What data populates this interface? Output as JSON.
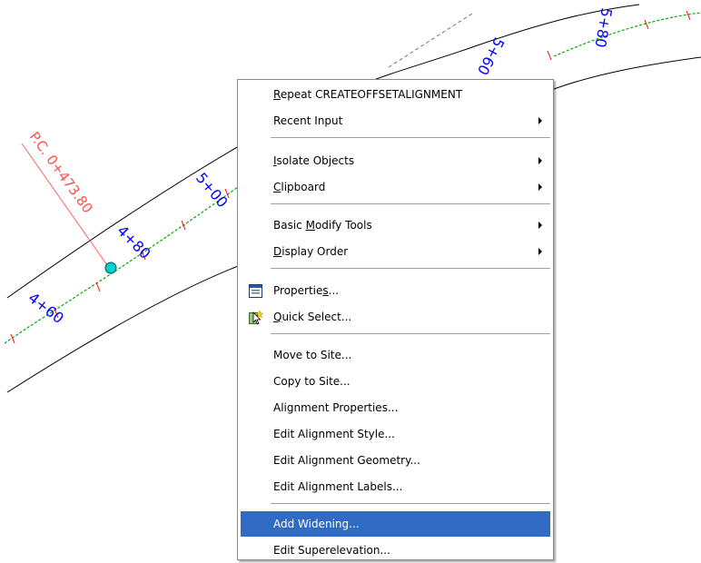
{
  "drawing": {
    "station_labels": [
      "4+60",
      "4+80",
      "5+00",
      "5+60",
      "5+80"
    ],
    "pc_label": "P.C. 0+473.80",
    "colors": {
      "alignment_line": "#00aa00",
      "station_text": "#0000ff",
      "pc_text": "#ff5050",
      "tick": "#ff0000",
      "point": "#00d0d0",
      "edge": "#000000"
    }
  },
  "context_menu": {
    "items": [
      {
        "label": "Repeat CREATEOFFSETALIGNMENT",
        "underline": "R",
        "rest": "epeat CREATEOFFSETALIGNMENT"
      },
      {
        "label": "Recent Input",
        "submenu": true
      },
      {
        "label": "Isolate Objects",
        "underline": "I",
        "rest": "solate Objects",
        "submenu": true
      },
      {
        "label": "Clipboard",
        "underline": "C",
        "rest": "lipboard",
        "submenu": true
      },
      {
        "label": "Basic Modify Tools",
        "pre": "Basic ",
        "underline": "M",
        "rest": "odify Tools",
        "submenu": true
      },
      {
        "label": "Display Order",
        "underline": "D",
        "rest": "isplay Order",
        "submenu": true
      },
      {
        "label": "Properties...",
        "pre": "Propertie",
        "underline": "s",
        "rest": "...",
        "icon": "properties-icon"
      },
      {
        "label": "Quick Select...",
        "underline": "Q",
        "rest": "uick Select...",
        "icon": "quick-select-icon"
      },
      {
        "label": "Move to Site..."
      },
      {
        "label": "Copy to Site..."
      },
      {
        "label": "Alignment Properties..."
      },
      {
        "label": "Edit Alignment Style..."
      },
      {
        "label": "Edit Alignment Geometry..."
      },
      {
        "label": "Edit Alignment Labels..."
      },
      {
        "label": "Add Widening...",
        "highlighted": true
      },
      {
        "label": "Edit Superelevation..."
      }
    ]
  }
}
